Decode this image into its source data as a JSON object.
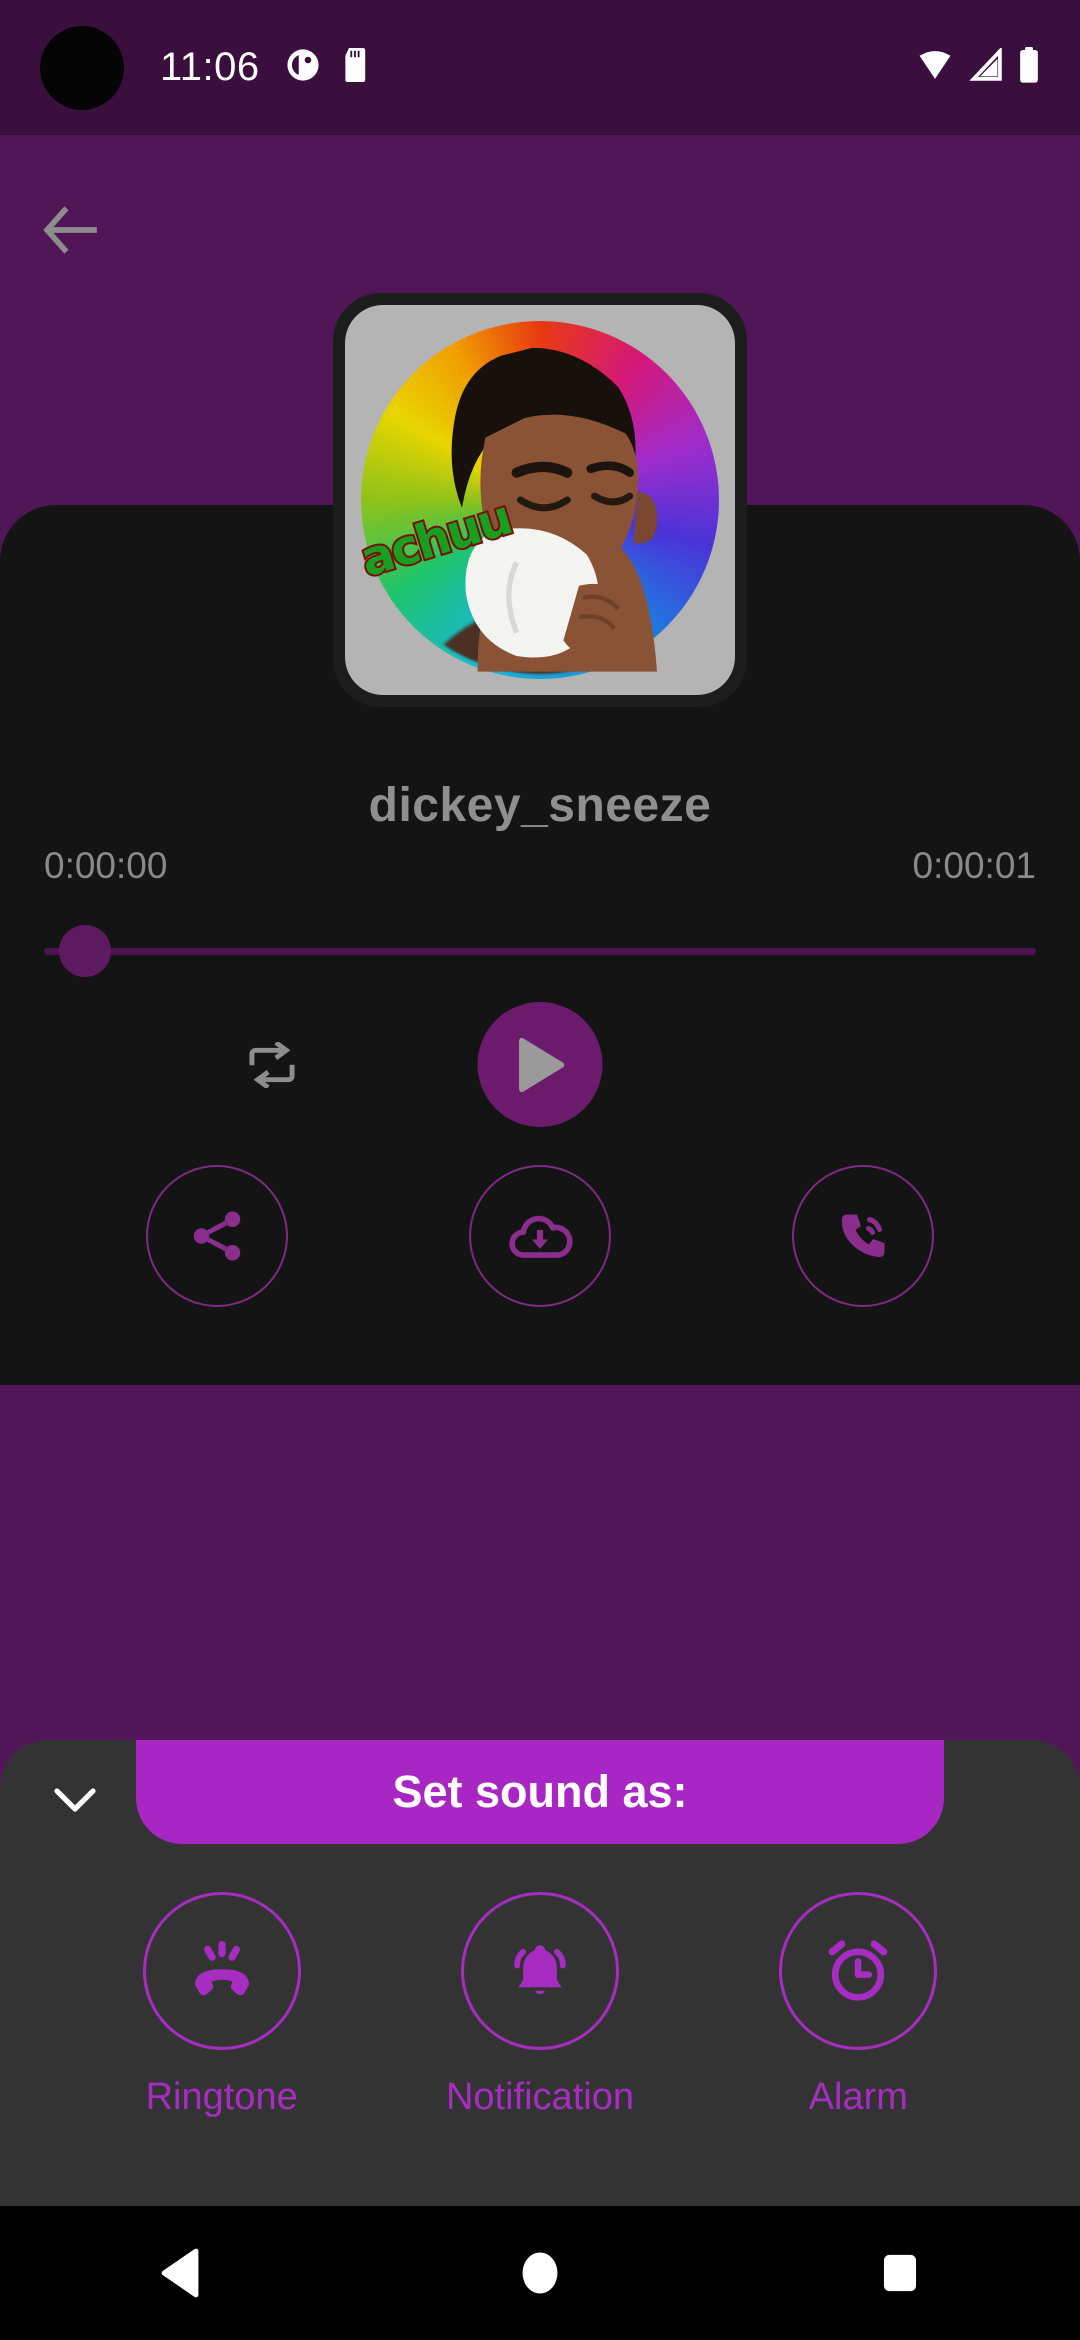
{
  "status_bar": {
    "time": "11:06",
    "icons": [
      "camera-punch-hole",
      "app-notification-icon",
      "sd-card-icon",
      "wifi-icon",
      "cellular-signal-icon",
      "battery-icon"
    ],
    "background_color": "#3a0f3e"
  },
  "app": {
    "background_color": "#511657",
    "card_color": "#141414",
    "accent_color": "#a726c4",
    "icon_purple": "#7d2a80"
  },
  "nav": {
    "back_icon": "arrow-left-icon"
  },
  "player": {
    "album_art_caption": "achuu",
    "track_title": "dickey_sneeze",
    "current_time": "0:00:00",
    "total_time": "0:00:01",
    "progress_percent": 0,
    "repeat_icon": "repeat-icon",
    "play_icon": "play-icon",
    "actions": [
      {
        "name": "share",
        "icon": "share-icon"
      },
      {
        "name": "download",
        "icon": "cloud-download-icon"
      },
      {
        "name": "set-as-call-tone",
        "icon": "phone-ring-icon"
      }
    ]
  },
  "bottom_sheet": {
    "collapse_icon": "chevron-down-icon",
    "title": "Set sound as:",
    "options": [
      {
        "label": "Ringtone",
        "icon": "phone-ringing-icon"
      },
      {
        "label": "Notification",
        "icon": "bell-ringing-icon"
      },
      {
        "label": "Alarm",
        "icon": "alarm-clock-icon"
      }
    ]
  },
  "system_nav": {
    "buttons": [
      {
        "name": "back",
        "icon": "triangle-back-icon"
      },
      {
        "name": "home",
        "icon": "circle-home-icon"
      },
      {
        "name": "recents",
        "icon": "square-recents-icon"
      }
    ]
  }
}
